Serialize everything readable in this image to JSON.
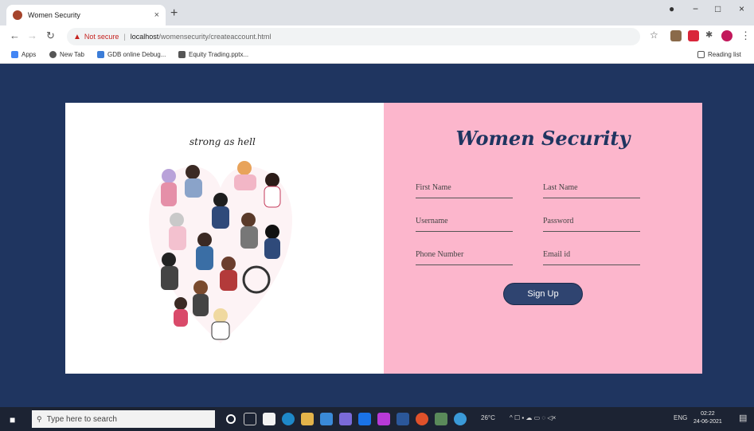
{
  "browser": {
    "tab_title": "Women Security",
    "tab_close": "×",
    "new_tab": "+",
    "not_secure": "Not secure",
    "url_host": "localhost",
    "url_path": "/womensecurity/createaccount.html",
    "window_controls": {
      "minimize": "−",
      "maximize": "□",
      "close": "×"
    }
  },
  "bookmarks": {
    "items": [
      {
        "label": "Apps",
        "icon": "apps-grid-icon"
      },
      {
        "label": "New Tab",
        "icon": "globe-icon"
      },
      {
        "label": "GDB online Debug...",
        "icon": "gdb-icon"
      },
      {
        "label": "Equity Trading.pptx...",
        "icon": "document-icon"
      }
    ],
    "reading_list": "Reading list"
  },
  "page": {
    "caption": "strong as hell",
    "form": {
      "title": "Women Security",
      "first_name_placeholder": "First Name",
      "last_name_placeholder": "Last Name",
      "username_placeholder": "Username",
      "password_placeholder": "Password",
      "phone_placeholder": "Phone Number",
      "email_placeholder": "Email id",
      "submit_label": "Sign Up"
    },
    "colors": {
      "background": "#1f3560",
      "panel_pink": "#fcb6cc",
      "title": "#1f3560",
      "button": "#2f4470"
    }
  },
  "taskbar": {
    "search_placeholder": "Type here to search",
    "weather": "26°C",
    "language": "ENG",
    "time": "02:22",
    "date": "24-06-2021"
  }
}
